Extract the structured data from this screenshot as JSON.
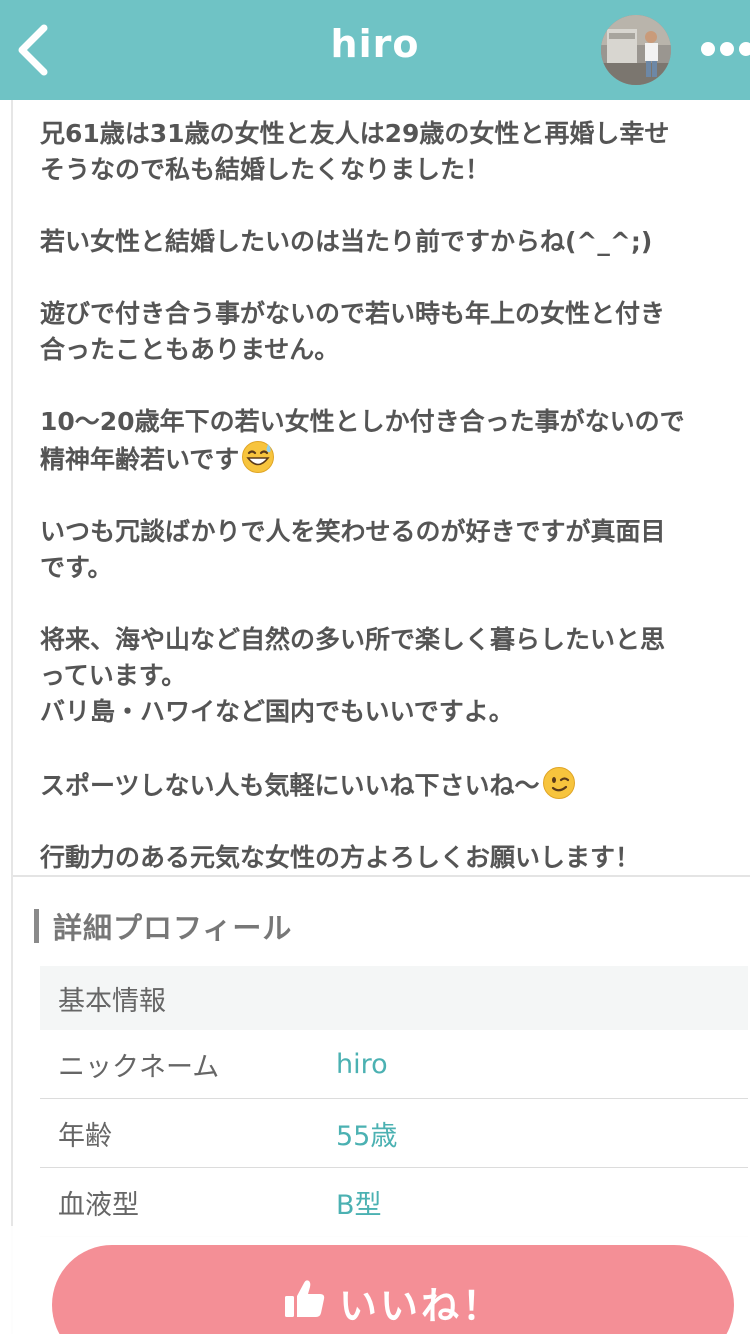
{
  "header": {
    "title": "hiro",
    "back_icon": "chevron-left-icon",
    "more_icon": "more-horizontal-icon",
    "background_color": "#6fc3c5"
  },
  "intro": {
    "paragraphs": [
      "兄61歳は31歳の女性と友人は29歳の女性と再婚し幸せ\nそうなので私も結婚したくなりました！",
      "若い女性と結婚したいのは当たり前ですからね(^_^;)",
      "遊びで付き合う事がないので若い時も年上の女性と付き\n合ったこともありません。",
      "10〜20歳年下の若い女性としか付き合った事がないので\n精神年齢若いです",
      "いつも冗談ばかりで人を笑わせるのが好きですが真面目\nです。",
      "将来、海や山など自然の多い所で楽しく暮らしたいと思\nっています。\nバリ島・ハワイなど国内でもいいですよ。",
      "スポーツしない人も気軽にいいね下さいね〜",
      "行動力のある元気な女性の方よろしくお願いします！"
    ],
    "emoji_sweat": "grinning-sweat-emoji",
    "emoji_wink": "winking-face-emoji"
  },
  "profile": {
    "section_title": "詳細プロフィール",
    "group_title": "基本情報",
    "rows": [
      {
        "label": "ニックネーム",
        "value": "hiro"
      },
      {
        "label": "年齢",
        "value": "55歳"
      },
      {
        "label": "血液型",
        "value": "B型"
      }
    ],
    "value_color": "#4bb1b2"
  },
  "like_button": {
    "label": "いいね！",
    "icon": "thumbs-up-icon",
    "color": "#f48f96"
  }
}
